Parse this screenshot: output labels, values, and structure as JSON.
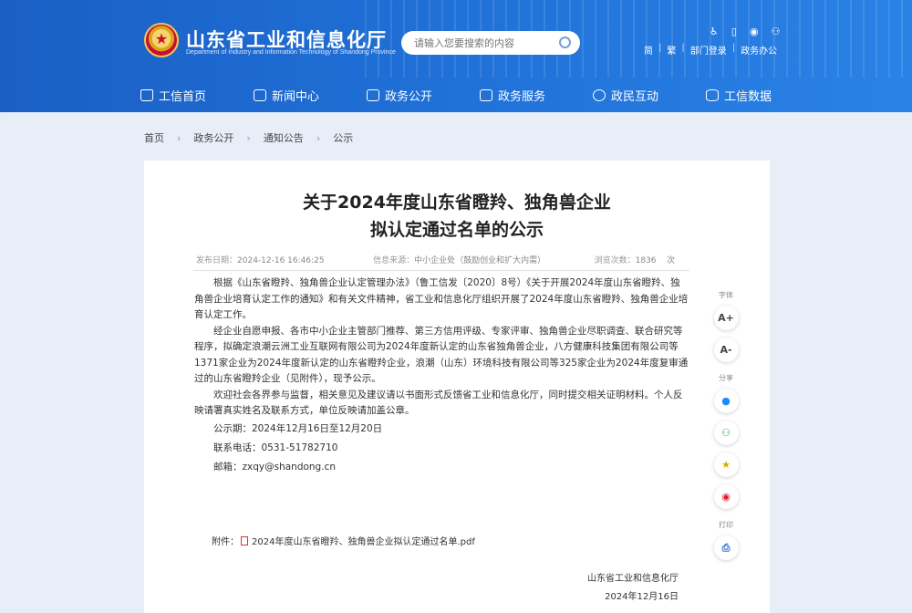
{
  "header": {
    "site_title": "山东省工业和信息化厅",
    "site_subtitle": "Department of Industry and Information Technology of Shandong Province",
    "search_placeholder": "请输入您要搜索的内容",
    "top_links": [
      "简",
      "繁",
      "部门登录",
      "政务办公"
    ],
    "top_icons": [
      "accessibility-icon",
      "mobile-icon",
      "weibo-icon",
      "wechat-icon"
    ]
  },
  "nav": {
    "items": [
      {
        "label": "工信首页",
        "icon": "home-icon"
      },
      {
        "label": "新闻中心",
        "icon": "news-icon"
      },
      {
        "label": "政务公开",
        "icon": "monitor-icon"
      },
      {
        "label": "政务服务",
        "icon": "service-icon"
      },
      {
        "label": "政民互动",
        "icon": "chat-icon"
      },
      {
        "label": "工信数据",
        "icon": "database-icon"
      }
    ]
  },
  "breadcrumb": {
    "items": [
      "首页",
      "政务公开",
      "通知公告",
      "公示"
    ],
    "sep": "›"
  },
  "article": {
    "title_line1": "关于2024年度山东省瞪羚、独角兽企业",
    "title_line2": "拟认定通过名单的公示",
    "meta": {
      "date_label": "发布日期：",
      "date": "2024-12-16 16:46:25",
      "source_label": "信息来源：",
      "source": "中小企业处（鼓励创业和扩大内需）",
      "views_label": "浏览次数：",
      "views": "1836",
      "views_unit": "次"
    },
    "paragraphs": [
      "根据《山东省瞪羚、独角兽企业认定管理办法》（鲁工信发〔2020〕8号）《关于开展2024年度山东省瞪羚、独角兽企业培育认定工作的通知》和有关文件精神，省工业和信息化厅组织开展了2024年度山东省瞪羚、独角兽企业培育认定工作。",
      "经企业自愿申报、各市中小企业主管部门推荐、第三方信用评级、专家评审、独角兽企业尽职调查、联合研究等程序，拟确定浪潮云洲工业互联网有限公司为2024年度新认定的山东省独角兽企业，八方健康科技集团有限公司等1371家企业为2024年度新认定的山东省瞪羚企业，浪潮（山东）环境科技有限公司等325家企业为2024年度复审通过的山东省瞪羚企业（见附件），现予公示。",
      "欢迎社会各界参与监督，相关意见及建议请以书面形式反馈省工业和信息化厅，同时提交相关证明材料。个人反映请署真实姓名及联系方式，单位反映请加盖公章。"
    ],
    "info_lines": [
      "公示期：2024年12月16日至12月20日",
      "联系电话：0531-51782710",
      "邮箱：zxqy@shandong.cn"
    ],
    "attachment_label": "附件：",
    "attachment_file": "2024年度山东省瞪羚、独角兽企业拟认定通过名单.pdf",
    "signature": "山东省工业和信息化厅",
    "sign_date": "2024年12月16日"
  },
  "tools": {
    "font_label": "字体",
    "font_increase": "A+",
    "font_decrease": "A-",
    "share_label": "分享",
    "print_label": "打印"
  },
  "colors": {
    "header_blue": "#1f6fd6",
    "page_bg": "#e8eef7"
  }
}
